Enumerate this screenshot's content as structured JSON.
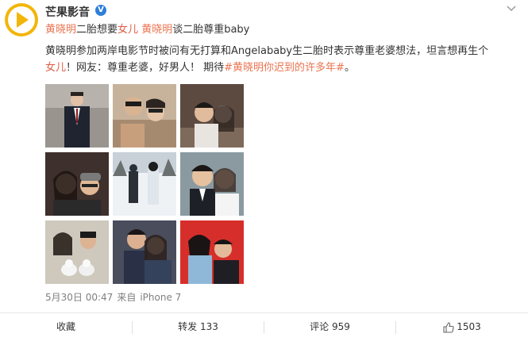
{
  "post": {
    "author": "芒果影音",
    "verified_badge": "V",
    "title_line": {
      "link1": "黄晓明",
      "text1": "二胎想要",
      "red1": "女儿",
      "link2": "黄晓明",
      "text2": "谈二胎尊重baby"
    },
    "body_line1": "黄晓明参加两岸电影节时被问有无打算和Angelababy生二胎时表示尊重老婆想法，坦言想再生个",
    "body_line2": {
      "red": "女儿",
      "text": "！网友：尊重老婆，好男人！ 期待",
      "hashtag": "#黄晓明你迟到的许多年#",
      "end": "。"
    },
    "timestamp": "5月30日 00:47",
    "source_prefix": "来自",
    "source": "iPhone 7"
  },
  "photos": [
    {
      "name": "photo-1",
      "bg": "#8b8580"
    },
    {
      "name": "photo-2",
      "bg": "#b09a85"
    },
    {
      "name": "photo-3",
      "bg": "#6f5a4f"
    },
    {
      "name": "photo-4",
      "bg": "#4a3a35"
    },
    {
      "name": "photo-5",
      "bg": "#e9eef2"
    },
    {
      "name": "photo-6",
      "bg": "#7a8a8f"
    },
    {
      "name": "photo-7",
      "bg": "#d8d2c8"
    },
    {
      "name": "photo-8",
      "bg": "#5a5a68"
    },
    {
      "name": "photo-9",
      "bg": "#d8302e"
    }
  ],
  "footer": {
    "collect": "收藏",
    "repost": "转发 133",
    "comment": "评论 959",
    "like": "1503"
  },
  "colors": {
    "link": "#eb7350",
    "meta": "#808080",
    "brand_yellow": "#f2b50a"
  }
}
